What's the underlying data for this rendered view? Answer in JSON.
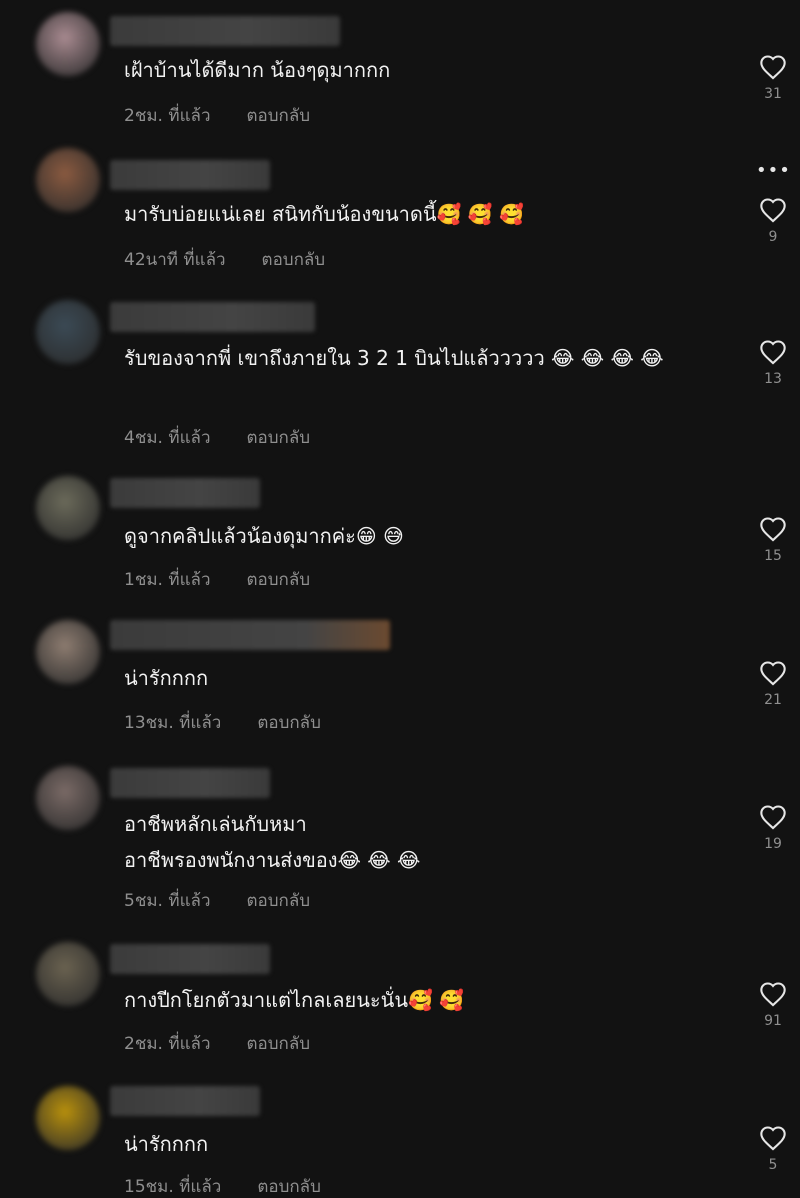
{
  "comments": [
    {
      "text": "เฝ้าบ้านได้ดีมาก น้องๆดุมากกก",
      "time": "2ชม. ที่แล้ว",
      "reply": "ตอบกลับ",
      "likes": "31",
      "avatar_color": "#a88a90"
    },
    {
      "text": "มารับบ่อยแน่เลย สนิทกับน้องขนาดนี้🥰 🥰 🥰",
      "time": "42นาที ที่แล้ว",
      "reply": "ตอบกลับ",
      "likes": "9",
      "avatar_color": "#8a5a40"
    },
    {
      "text": "รับของจากพี่ เขาถึงภายใน 3 2 1 บินไปแล้ววววว 😂 😂 😂 😂",
      "time": "4ชม. ที่แล้ว",
      "reply": "ตอบกลับ",
      "likes": "13",
      "avatar_color": "#3b4a55"
    },
    {
      "text": "ดูจากคลิปแล้วน้องดุมากค่ะ😁 😅",
      "time": "1ชม. ที่แล้ว",
      "reply": "ตอบกลับ",
      "likes": "15",
      "avatar_color": "#6b6a5a"
    },
    {
      "text": "น่ารักกกก",
      "time": "13ชม. ที่แล้ว",
      "reply": "ตอบกลับ",
      "likes": "21",
      "avatar_color": "#8d7c70"
    },
    {
      "text": "อาชีพหลักเล่นกับหมา\nอาชีพรองพนักงานส่งของ😂 😂 😂",
      "time": "5ชม. ที่แล้ว",
      "reply": "ตอบกลับ",
      "likes": "19",
      "avatar_color": "#7a6a66"
    },
    {
      "text": "กางปีกโยกตัวมาแต่ไกลเลยนะนั่น🥰 🥰",
      "time": "2ชม. ที่แล้ว",
      "reply": "ตอบกลับ",
      "likes": "91",
      "avatar_color": "#6a6250"
    },
    {
      "text": "น่ารักกกก",
      "time": "15ชม. ที่แล้ว",
      "reply": "ตอบกลับ",
      "likes": "5",
      "avatar_color": "#b8900c"
    }
  ],
  "more_icon": "more-dots-icon",
  "like_icon": "heart-outline-icon"
}
